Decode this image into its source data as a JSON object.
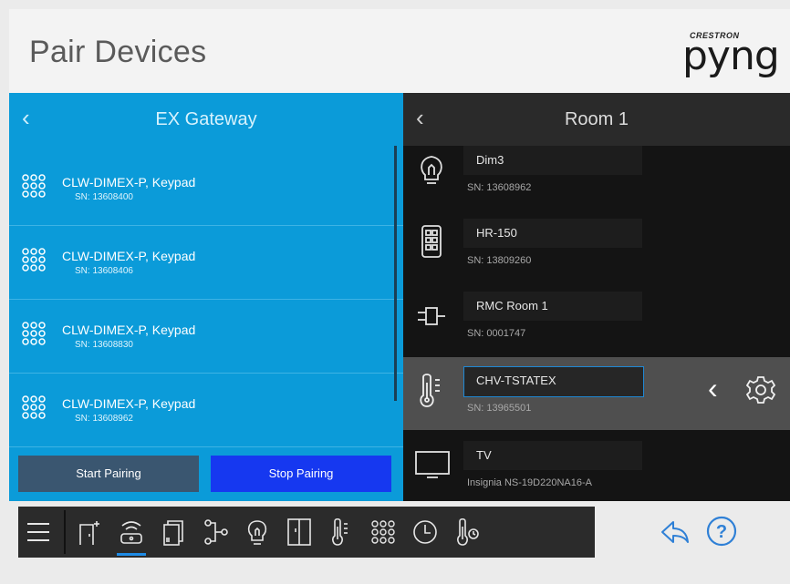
{
  "header": {
    "title": "Pair Devices",
    "logo_small": "CRESTRON",
    "logo_big": "pyng"
  },
  "gateway_panel": {
    "back_glyph": "‹",
    "title": "EX Gateway",
    "devices": [
      {
        "name": "CLW-DIMEX-P, Keypad",
        "sn": "SN: 13608400",
        "icon": "keypad-icon"
      },
      {
        "name": "CLW-DIMEX-P, Keypad",
        "sn": "SN: 13608406",
        "icon": "keypad-icon"
      },
      {
        "name": "CLW-DIMEX-P, Keypad",
        "sn": "SN: 13608830",
        "icon": "keypad-icon"
      },
      {
        "name": "CLW-DIMEX-P, Keypad",
        "sn": "SN: 13608962",
        "icon": "keypad-icon"
      }
    ],
    "start_label": "Start Pairing",
    "stop_label": "Stop Pairing"
  },
  "room_panel": {
    "back_glyph": "‹",
    "title": "Room 1",
    "devices": [
      {
        "name": "Dim3",
        "sn": "SN: 13608962",
        "icon": "lightbulb-icon"
      },
      {
        "name": "HR-150",
        "sn": "SN: 13809260",
        "icon": "remote-icon"
      },
      {
        "name": "RMC Room 1",
        "sn": "SN: 0001747",
        "icon": "controller-icon"
      },
      {
        "name": "CHV-TSTATEX",
        "sn": "SN: 13965501",
        "icon": "thermometer-icon",
        "selected": true
      },
      {
        "name": "TV",
        "sn": "Insignia NS-19D220NA16-A",
        "icon": "tv-icon"
      }
    ],
    "selected_back_glyph": "‹"
  },
  "toolbar": {
    "items": [
      "menu-icon",
      "door-icon",
      "gateway-icon",
      "shades-icon",
      "hub-icon",
      "lightbulb-icon",
      "window-icon",
      "thermometer-icon",
      "keypad-icon",
      "clock-icon",
      "temperature-sensor-icon"
    ],
    "active": "gateway-icon"
  },
  "colors": {
    "blue_panel": "#0b9bd9",
    "stop_button": "#1638f0",
    "start_button": "#3a5670",
    "accent": "#1e8be6"
  }
}
